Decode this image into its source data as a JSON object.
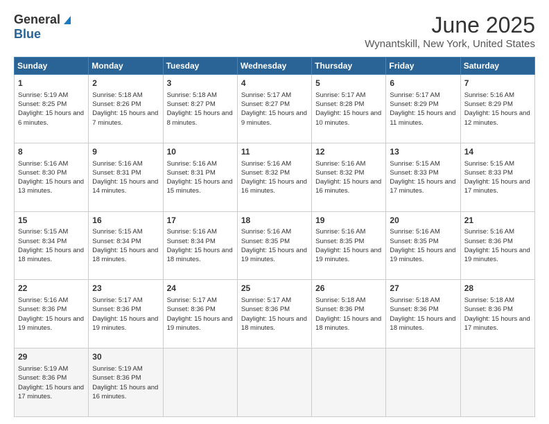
{
  "logo": {
    "general": "General",
    "blue": "Blue"
  },
  "header": {
    "title": "June 2025",
    "subtitle": "Wynantskill, New York, United States"
  },
  "days_of_week": [
    "Sunday",
    "Monday",
    "Tuesday",
    "Wednesday",
    "Thursday",
    "Friday",
    "Saturday"
  ],
  "weeks": [
    [
      {
        "day": "1",
        "sunrise": "Sunrise: 5:19 AM",
        "sunset": "Sunset: 8:25 PM",
        "daylight": "Daylight: 15 hours and 6 minutes."
      },
      {
        "day": "2",
        "sunrise": "Sunrise: 5:18 AM",
        "sunset": "Sunset: 8:26 PM",
        "daylight": "Daylight: 15 hours and 7 minutes."
      },
      {
        "day": "3",
        "sunrise": "Sunrise: 5:18 AM",
        "sunset": "Sunset: 8:27 PM",
        "daylight": "Daylight: 15 hours and 8 minutes."
      },
      {
        "day": "4",
        "sunrise": "Sunrise: 5:17 AM",
        "sunset": "Sunset: 8:27 PM",
        "daylight": "Daylight: 15 hours and 9 minutes."
      },
      {
        "day": "5",
        "sunrise": "Sunrise: 5:17 AM",
        "sunset": "Sunset: 8:28 PM",
        "daylight": "Daylight: 15 hours and 10 minutes."
      },
      {
        "day": "6",
        "sunrise": "Sunrise: 5:17 AM",
        "sunset": "Sunset: 8:29 PM",
        "daylight": "Daylight: 15 hours and 11 minutes."
      },
      {
        "day": "7",
        "sunrise": "Sunrise: 5:16 AM",
        "sunset": "Sunset: 8:29 PM",
        "daylight": "Daylight: 15 hours and 12 minutes."
      }
    ],
    [
      {
        "day": "8",
        "sunrise": "Sunrise: 5:16 AM",
        "sunset": "Sunset: 8:30 PM",
        "daylight": "Daylight: 15 hours and 13 minutes."
      },
      {
        "day": "9",
        "sunrise": "Sunrise: 5:16 AM",
        "sunset": "Sunset: 8:31 PM",
        "daylight": "Daylight: 15 hours and 14 minutes."
      },
      {
        "day": "10",
        "sunrise": "Sunrise: 5:16 AM",
        "sunset": "Sunset: 8:31 PM",
        "daylight": "Daylight: 15 hours and 15 minutes."
      },
      {
        "day": "11",
        "sunrise": "Sunrise: 5:16 AM",
        "sunset": "Sunset: 8:32 PM",
        "daylight": "Daylight: 15 hours and 16 minutes."
      },
      {
        "day": "12",
        "sunrise": "Sunrise: 5:16 AM",
        "sunset": "Sunset: 8:32 PM",
        "daylight": "Daylight: 15 hours and 16 minutes."
      },
      {
        "day": "13",
        "sunrise": "Sunrise: 5:15 AM",
        "sunset": "Sunset: 8:33 PM",
        "daylight": "Daylight: 15 hours and 17 minutes."
      },
      {
        "day": "14",
        "sunrise": "Sunrise: 5:15 AM",
        "sunset": "Sunset: 8:33 PM",
        "daylight": "Daylight: 15 hours and 17 minutes."
      }
    ],
    [
      {
        "day": "15",
        "sunrise": "Sunrise: 5:15 AM",
        "sunset": "Sunset: 8:34 PM",
        "daylight": "Daylight: 15 hours and 18 minutes."
      },
      {
        "day": "16",
        "sunrise": "Sunrise: 5:15 AM",
        "sunset": "Sunset: 8:34 PM",
        "daylight": "Daylight: 15 hours and 18 minutes."
      },
      {
        "day": "17",
        "sunrise": "Sunrise: 5:16 AM",
        "sunset": "Sunset: 8:34 PM",
        "daylight": "Daylight: 15 hours and 18 minutes."
      },
      {
        "day": "18",
        "sunrise": "Sunrise: 5:16 AM",
        "sunset": "Sunset: 8:35 PM",
        "daylight": "Daylight: 15 hours and 19 minutes."
      },
      {
        "day": "19",
        "sunrise": "Sunrise: 5:16 AM",
        "sunset": "Sunset: 8:35 PM",
        "daylight": "Daylight: 15 hours and 19 minutes."
      },
      {
        "day": "20",
        "sunrise": "Sunrise: 5:16 AM",
        "sunset": "Sunset: 8:35 PM",
        "daylight": "Daylight: 15 hours and 19 minutes."
      },
      {
        "day": "21",
        "sunrise": "Sunrise: 5:16 AM",
        "sunset": "Sunset: 8:36 PM",
        "daylight": "Daylight: 15 hours and 19 minutes."
      }
    ],
    [
      {
        "day": "22",
        "sunrise": "Sunrise: 5:16 AM",
        "sunset": "Sunset: 8:36 PM",
        "daylight": "Daylight: 15 hours and 19 minutes."
      },
      {
        "day": "23",
        "sunrise": "Sunrise: 5:17 AM",
        "sunset": "Sunset: 8:36 PM",
        "daylight": "Daylight: 15 hours and 19 minutes."
      },
      {
        "day": "24",
        "sunrise": "Sunrise: 5:17 AM",
        "sunset": "Sunset: 8:36 PM",
        "daylight": "Daylight: 15 hours and 19 minutes."
      },
      {
        "day": "25",
        "sunrise": "Sunrise: 5:17 AM",
        "sunset": "Sunset: 8:36 PM",
        "daylight": "Daylight: 15 hours and 18 minutes."
      },
      {
        "day": "26",
        "sunrise": "Sunrise: 5:18 AM",
        "sunset": "Sunset: 8:36 PM",
        "daylight": "Daylight: 15 hours and 18 minutes."
      },
      {
        "day": "27",
        "sunrise": "Sunrise: 5:18 AM",
        "sunset": "Sunset: 8:36 PM",
        "daylight": "Daylight: 15 hours and 18 minutes."
      },
      {
        "day": "28",
        "sunrise": "Sunrise: 5:18 AM",
        "sunset": "Sunset: 8:36 PM",
        "daylight": "Daylight: 15 hours and 17 minutes."
      }
    ],
    [
      {
        "day": "29",
        "sunrise": "Sunrise: 5:19 AM",
        "sunset": "Sunset: 8:36 PM",
        "daylight": "Daylight: 15 hours and 17 minutes."
      },
      {
        "day": "30",
        "sunrise": "Sunrise: 5:19 AM",
        "sunset": "Sunset: 8:36 PM",
        "daylight": "Daylight: 15 hours and 16 minutes."
      },
      null,
      null,
      null,
      null,
      null
    ]
  ]
}
